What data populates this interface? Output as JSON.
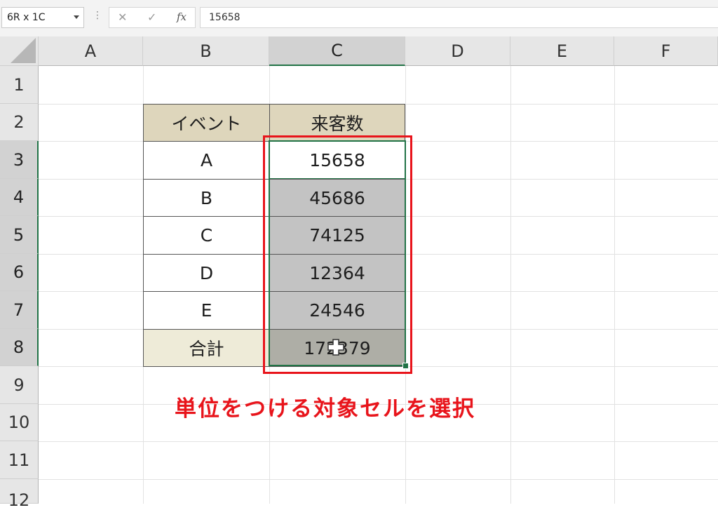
{
  "formula_bar": {
    "name_box": "6R x 1C",
    "formula_value": "15658",
    "fx_label": "fx"
  },
  "column_headers": [
    "A",
    "B",
    "C",
    "D",
    "E",
    "F"
  ],
  "row_headers": [
    "1",
    "2",
    "3",
    "4",
    "5",
    "6",
    "7",
    "8",
    "9",
    "10",
    "11",
    "12"
  ],
  "table": {
    "header_event": "イベント",
    "header_visitors": "来客数",
    "rows": [
      {
        "event": "A",
        "visitors": "15658"
      },
      {
        "event": "B",
        "visitors": "45686"
      },
      {
        "event": "C",
        "visitors": "74125"
      },
      {
        "event": "D",
        "visitors": "12364"
      },
      {
        "event": "E",
        "visitors": "24546"
      }
    ],
    "total_label": "合計",
    "total_value": "172379"
  },
  "annotation": "単位をつける対象セルを選択",
  "colors": {
    "accent_green": "#217346",
    "annotation_red": "#e8141b",
    "header_fill": "#ded6bc",
    "total_fill": "#eeebd8"
  }
}
